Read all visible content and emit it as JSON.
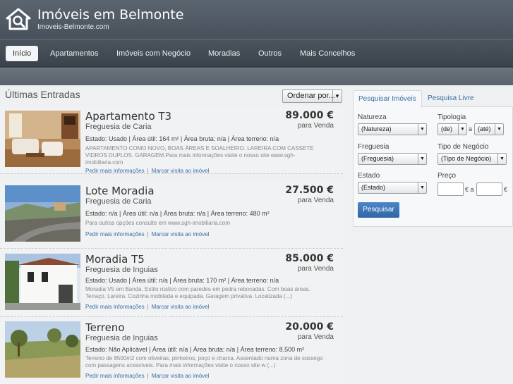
{
  "site": {
    "title": "Imóveis em Belmonte",
    "subtitle": "Imoveis-Belmonte.com"
  },
  "nav": [
    "Início",
    "Apartamentos",
    "Imóveis com Negócio",
    "Moradias",
    "Outros",
    "Mais Concelhos"
  ],
  "list": {
    "title": "Últimas Entradas",
    "sort_label": "Ordenar por..."
  },
  "listings": [
    {
      "title": "Apartamento  T3",
      "area": "Freguesia de Caria",
      "price": "89.000 €",
      "purpose": "para Venda",
      "details": "Estado: Usado  | Área útil: 164 m²  | Área bruta: n/a  | Área terreno: n/a",
      "description": "APARTAMENTO COMO NOVO, BOAS ÁREAS E SOALHEIRO. LAREIRA COM CASSETE VIDROS DUPLOS. GARAGEM.Para mais informações visite o nosso site www.sgh-imobiliaria.com",
      "link_info": "Pedir mais informações",
      "link_visit": "Marcar visita ao imóvel"
    },
    {
      "title": "Lote Moradia",
      "area": "Freguesia de Caria",
      "price": "27.500 €",
      "purpose": "para Venda",
      "details": "Estado: n/a  | Área útil: n/a  | Área bruta: n/a  | Área terreno: 480 m²",
      "description": "Para outras opções consulte em www.sgh-imobiliaria.com",
      "link_info": "Pedir mais informações",
      "link_visit": "Marcar visita ao imóvel"
    },
    {
      "title": "Moradia  T5",
      "area": "Freguesia de Inguias",
      "price": "85.000 €",
      "purpose": "para Venda",
      "details": "Estado: Usado  | Área útil: n/a  | Área bruta: 170 m²  | Área terreno: n/a",
      "description": "Moradia V5 em Banda. Estilo rústico com paredes em pedra rebocadas. Com boas áreas. Terraço. Lareira. Cozinha mobilada e equipada. Garagem privativa. Localizada (...)",
      "link_info": "Pedir mais informações",
      "link_visit": "Marcar visita ao imóvel"
    },
    {
      "title": "Terreno",
      "area": "Freguesia de Inguias",
      "price": "20.000 €",
      "purpose": "para Venda",
      "details": "Estado: Não Aplicável  | Área útil: n/a  | Área bruta: n/a  | Área terreno: 8.500 m²",
      "description": "Terreno de 8500m2 com oliveiras, pinheiros, poço e charca. Assentado numa zona de sossego com passagens acessíveis. Para mais informações visite o nosso site w (...)",
      "link_info": "Pedir mais informações",
      "link_visit": "Marcar visita ao imóvel"
    }
  ],
  "search": {
    "tab_active": "Pesquisar Imóveis",
    "tab_free": "Pesquisa Livre",
    "natureza_label": "Natureza",
    "natureza_value": "(Natureza)",
    "tipologia_label": "Tipologia",
    "tipologia_from": "(de)",
    "tipologia_sep": "a",
    "tipologia_to": "(até)",
    "freguesia_label": "Freguesia",
    "freguesia_value": "(Freguesia)",
    "negocio_label": "Tipo de Negócio",
    "negocio_value": "(Tipo de Negócio)",
    "estado_label": "Estado",
    "estado_value": "(Estado)",
    "preco_label": "Preço",
    "preco_currency1": "€ a",
    "preco_currency2": "€",
    "button": "Pesquisar"
  }
}
